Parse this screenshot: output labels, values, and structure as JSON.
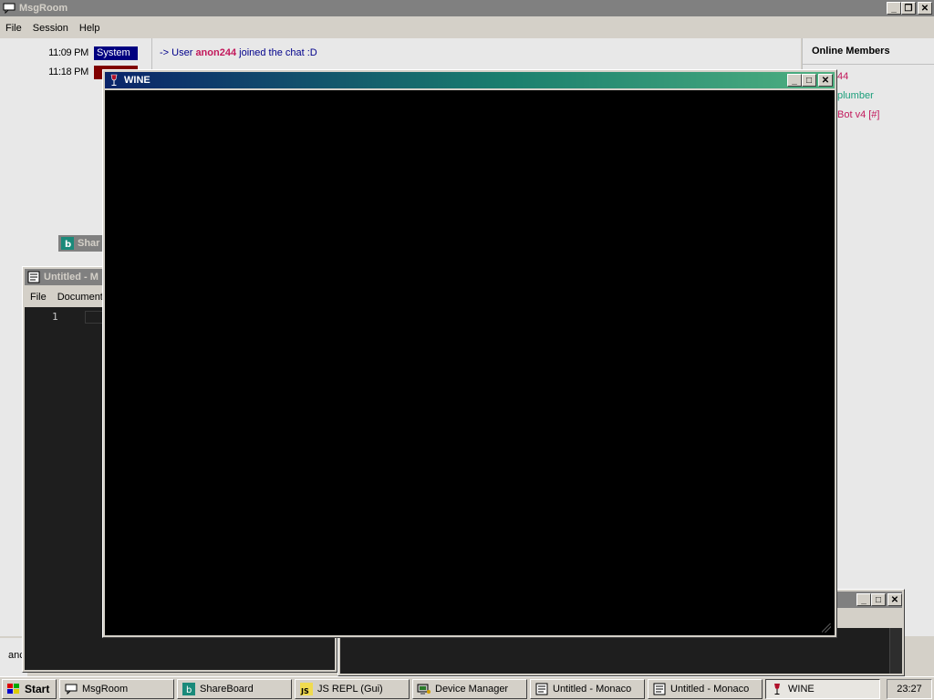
{
  "msgroom": {
    "title": "MsgRoom",
    "menu": [
      "File",
      "Session",
      "Help"
    ],
    "messages": [
      {
        "time": "11:09 PM",
        "user": "System",
        "user_color": "#000080",
        "prefix": "-> User ",
        "name": "anon244",
        "suffix": " joined the chat :D"
      },
      {
        "time": "11:18 PM",
        "user": "",
        "user_color": "#800000"
      }
    ],
    "members_title": "Online Members",
    "members": [
      "44",
      "plumber",
      "Bot v4 [#]"
    ],
    "status_text": "anc"
  },
  "shareboard": {
    "title": "Shar"
  },
  "monaco": {
    "title": "Untitled - M",
    "menu": [
      "File",
      "Document"
    ],
    "line_number": "1"
  },
  "wine": {
    "title": "WINE"
  },
  "taskbar": {
    "start": "Start",
    "tasks": [
      "MsgRoom",
      "ShareBoard",
      "JS REPL (Gui)",
      "Device Manager",
      "Untitled - Monaco",
      "Untitled - Monaco",
      "WINE"
    ],
    "clock": "23:27"
  },
  "colors": {
    "accent": "#0a246a",
    "chat_link": "#00008b",
    "username": "#c2185b",
    "member_green": "#1a9e7a"
  }
}
